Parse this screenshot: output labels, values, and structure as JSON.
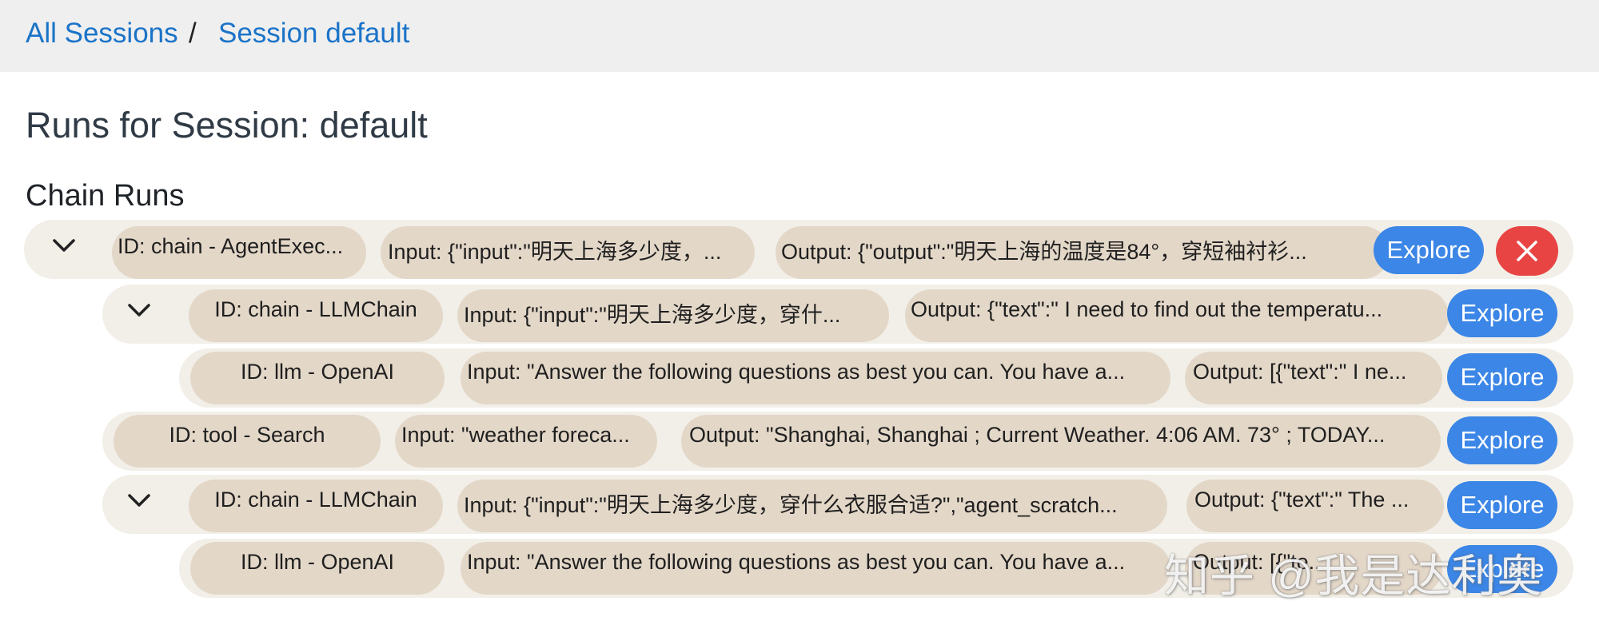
{
  "breadcrumb": {
    "items": [
      "All Sessions",
      "Session default"
    ],
    "separator": "/"
  },
  "page_title": "Runs for Session: default",
  "section_title": "Chain Runs",
  "runs": [
    {
      "id": "ID: chain - AgentExec...",
      "input": "Input: {\"input\":\"明天上海多少度，...",
      "output": "Output: {\"output\":\"明天上海的温度是84°，穿短袖衬衫...",
      "explore_label": "Explore",
      "expanded": true,
      "has_delete": true
    },
    {
      "id": "ID: chain - LLMChain",
      "input": "Input: {\"input\":\"明天上海多少度，穿什...",
      "output": "Output: {\"text\":\" I need to find out the temperatu...",
      "explore_label": "Explore",
      "expanded": true
    },
    {
      "id": "ID: llm - OpenAI",
      "input": "Input: \"Answer the following questions as best you can. You have a...",
      "output": "Output: [{\"text\":\" I ne...",
      "explore_label": "Explore"
    },
    {
      "id": "ID: tool - Search",
      "input": "Input: \"weather foreca...",
      "output": "Output: \"Shanghai, Shanghai ; Current Weather. 4:06 AM. 73° ; TODAY...",
      "explore_label": "Explore"
    },
    {
      "id": "ID: chain - LLMChain",
      "input": "Input: {\"input\":\"明天上海多少度，穿什么衣服合适?\",\"agent_scratch...",
      "output": "Output: {\"text\":\" The ...",
      "explore_label": "Explore",
      "expanded": true
    },
    {
      "id": "ID: llm - OpenAI",
      "input": "Input: \"Answer the following questions as best you can. You have a...",
      "output": "Output: [{\"te...",
      "explore_label": "Explore"
    }
  ],
  "watermark": "知乎 @我是达利奥",
  "colors": {
    "accent": "#3b86e6",
    "danger": "#e84444",
    "pill": "#e3d7c8",
    "row": "#f2efe8",
    "link": "#1a73c8"
  },
  "icons": {
    "expand": "chevron-down-icon",
    "delete": "close-icon"
  }
}
